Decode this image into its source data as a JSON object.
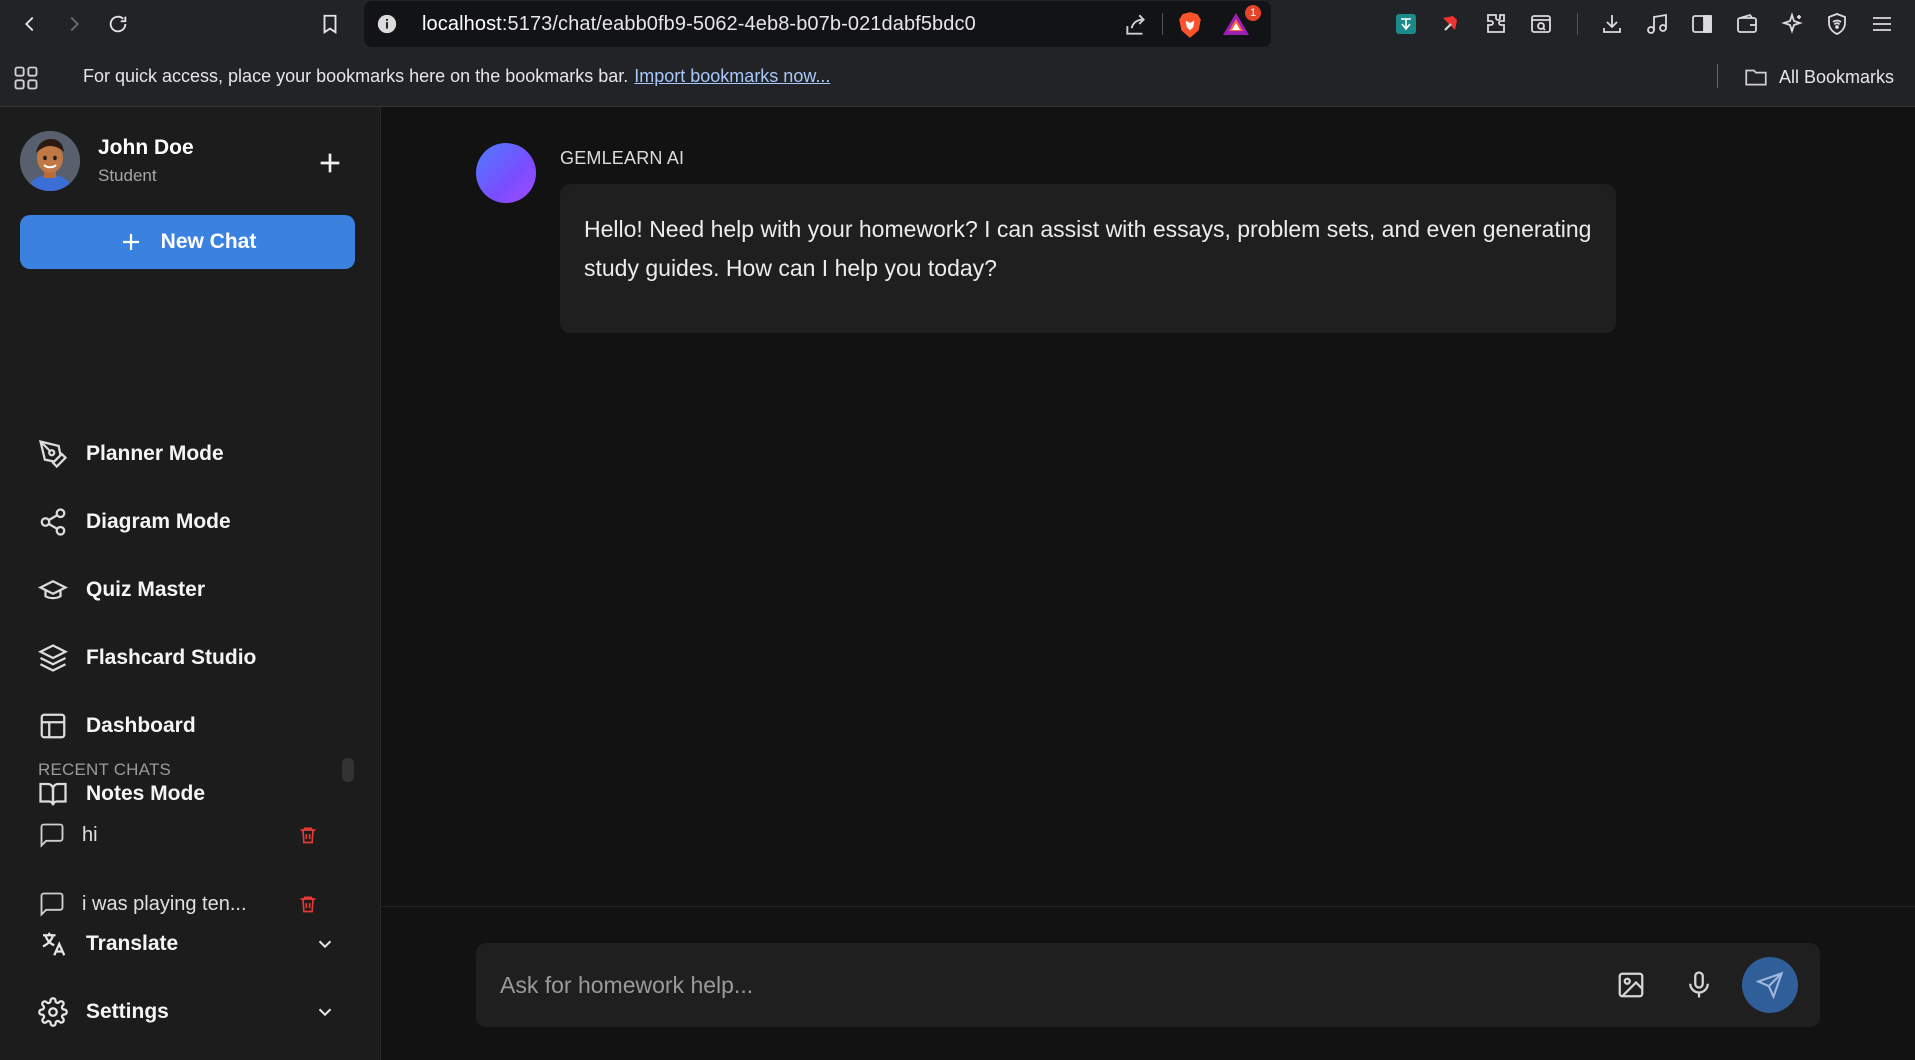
{
  "browser": {
    "url_host": "localhost",
    "url_path": ":5173/chat/eabb0fb9-5062-4eb8-b07b-021dabf5bdc0",
    "rewards_badge": "1",
    "bookmarks_bar": {
      "message": "For quick access, place your bookmarks here on the bookmarks bar.",
      "import_link": "Import bookmarks now...",
      "all_bookmarks": "All Bookmarks"
    }
  },
  "sidebar": {
    "user": {
      "name": "John Doe",
      "role": "Student"
    },
    "new_chat_label": "New Chat",
    "menu": [
      {
        "label": "Planner Mode",
        "icon": "pen-tool-icon"
      },
      {
        "label": "Diagram Mode",
        "icon": "share-nodes-icon"
      },
      {
        "label": "Quiz Master",
        "icon": "graduation-cap-icon"
      },
      {
        "label": "Flashcard Studio",
        "icon": "layers-icon"
      },
      {
        "label": "Dashboard",
        "icon": "layout-icon"
      },
      {
        "label": "Notes Mode",
        "icon": "book-open-icon"
      }
    ],
    "recent_title": "RECENT CHATS",
    "recent_chats": [
      {
        "label": "hi"
      },
      {
        "label": "i was playing ten..."
      }
    ],
    "translate_label": "Translate",
    "settings_label": "Settings"
  },
  "chat": {
    "assistant_name": "GEMLEARN AI",
    "message": "Hello! Need help with your homework? I can assist with essays, problem sets, and even generating study guides. How can I help you today?"
  },
  "composer": {
    "placeholder": "Ask for homework help..."
  },
  "colors": {
    "accent": "#3b82e0",
    "sidebar_bg": "#1c1c1d",
    "main_bg": "#121212",
    "bubble_bg": "#1f1f20",
    "delete": "#e53935"
  }
}
